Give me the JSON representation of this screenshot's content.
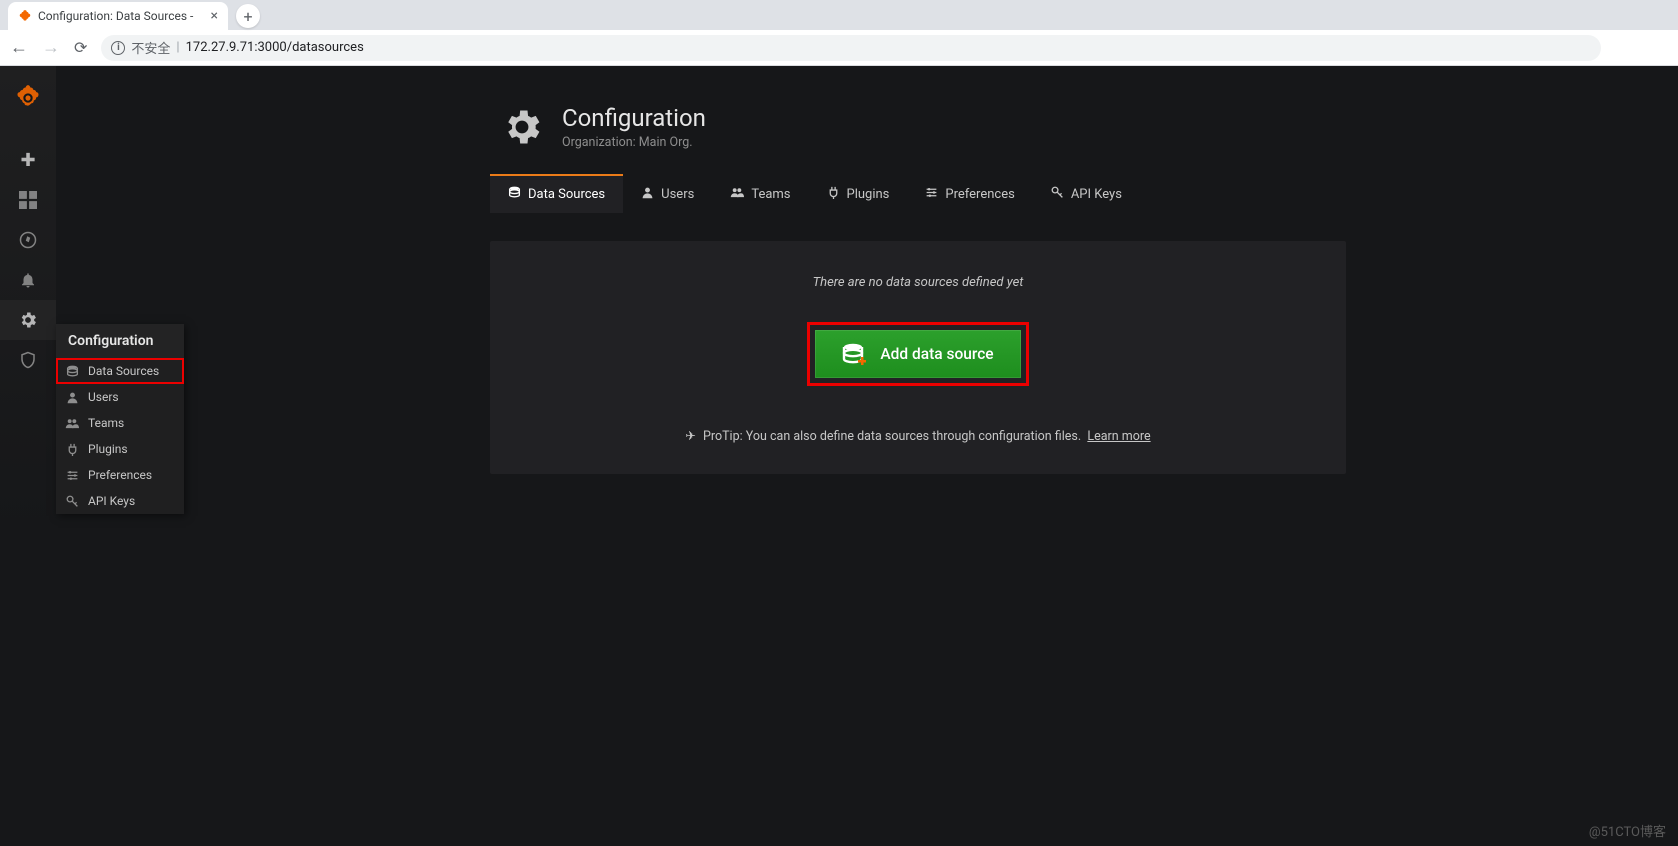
{
  "browser": {
    "tab_title": "Configuration: Data Sources -",
    "security_label": "不安全",
    "url": "172.27.9.71:3000/datasources"
  },
  "sidebar": {
    "popup_header": "Configuration",
    "items": [
      {
        "label": "Data Sources",
        "highlighted": true,
        "icon": "database"
      },
      {
        "label": "Users",
        "highlighted": false,
        "icon": "user"
      },
      {
        "label": "Teams",
        "highlighted": false,
        "icon": "users"
      },
      {
        "label": "Plugins",
        "highlighted": false,
        "icon": "plug"
      },
      {
        "label": "Preferences",
        "highlighted": false,
        "icon": "sliders"
      },
      {
        "label": "API Keys",
        "highlighted": false,
        "icon": "key"
      }
    ]
  },
  "page": {
    "title": "Configuration",
    "subtitle": "Organization: Main Org."
  },
  "tabs": [
    {
      "label": "Data Sources",
      "active": true,
      "icon": "database"
    },
    {
      "label": "Users",
      "active": false,
      "icon": "user"
    },
    {
      "label": "Teams",
      "active": false,
      "icon": "users"
    },
    {
      "label": "Plugins",
      "active": false,
      "icon": "plug"
    },
    {
      "label": "Preferences",
      "active": false,
      "icon": "sliders"
    },
    {
      "label": "API Keys",
      "active": false,
      "icon": "key"
    }
  ],
  "content": {
    "empty_message": "There are no data sources defined yet",
    "add_button_label": "Add data source",
    "protip_prefix": "ProTip: You can also define data sources through configuration files.",
    "learn_more_label": "Learn more"
  },
  "watermark": "@51CTO博客"
}
